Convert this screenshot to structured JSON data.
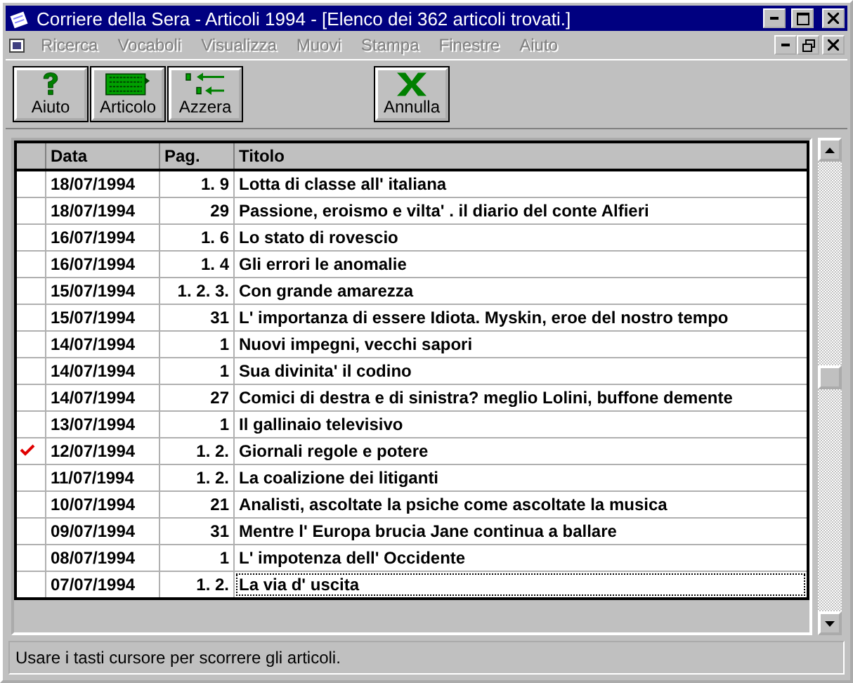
{
  "window": {
    "title": "Corriere della Sera -  Articoli 1994 - [Elenco dei 362 articoli trovati.]"
  },
  "menu": [
    {
      "label": "Ricerca",
      "disabled": true
    },
    {
      "label": "Vocaboli",
      "disabled": true
    },
    {
      "label": "Visualizza",
      "disabled": true
    },
    {
      "label": "Muovi",
      "disabled": true
    },
    {
      "label": "Stampa",
      "disabled": true
    },
    {
      "label": "Finestre",
      "disabled": true
    },
    {
      "label": "Aiuto",
      "disabled": true
    }
  ],
  "toolbar": [
    {
      "kind": "help",
      "label": "Aiuto"
    },
    {
      "kind": "article",
      "label": "Articolo"
    },
    {
      "kind": "reset",
      "label": "Azzera"
    },
    {
      "kind": "cancel",
      "label": "Annulla"
    }
  ],
  "table": {
    "columns": [
      "Data",
      "Pag.",
      "Titolo"
    ],
    "rows": [
      {
        "date": "18/07/1994",
        "page": "1. 9",
        "title": "Lotta di classe all' italiana",
        "checked": false,
        "focused": false
      },
      {
        "date": "18/07/1994",
        "page": "29",
        "title": "Passione, eroismo e vilta' . il diario del conte Alfieri",
        "checked": false,
        "focused": false
      },
      {
        "date": "16/07/1994",
        "page": "1. 6",
        "title": "Lo stato di rovescio",
        "checked": false,
        "focused": false
      },
      {
        "date": "16/07/1994",
        "page": "1. 4",
        "title": "Gli errori le anomalie",
        "checked": false,
        "focused": false
      },
      {
        "date": "15/07/1994",
        "page": "1. 2. 3.",
        "title": "Con grande amarezza",
        "checked": false,
        "focused": false
      },
      {
        "date": "15/07/1994",
        "page": "31",
        "title": "L' importanza di essere Idiota. Myskin, eroe del nostro tempo",
        "checked": false,
        "focused": false
      },
      {
        "date": "14/07/1994",
        "page": "1",
        "title": "Nuovi impegni, vecchi sapori",
        "checked": false,
        "focused": false
      },
      {
        "date": "14/07/1994",
        "page": "1",
        "title": "Sua divinita' il codino",
        "checked": false,
        "focused": false
      },
      {
        "date": "14/07/1994",
        "page": "27",
        "title": "Comici di destra e di sinistra? meglio Lolini, buffone demente",
        "checked": false,
        "focused": false
      },
      {
        "date": "13/07/1994",
        "page": "1",
        "title": "Il gallinaio televisivo",
        "checked": false,
        "focused": false
      },
      {
        "date": "12/07/1994",
        "page": "1. 2.",
        "title": "Giornali regole e potere",
        "checked": true,
        "focused": false
      },
      {
        "date": "11/07/1994",
        "page": "1. 2.",
        "title": "La coalizione dei litiganti",
        "checked": false,
        "focused": false
      },
      {
        "date": "10/07/1994",
        "page": "21",
        "title": "Analisti, ascoltate la psiche come ascoltate la musica",
        "checked": false,
        "focused": false
      },
      {
        "date": "09/07/1994",
        "page": "31",
        "title": "Mentre l' Europa brucia Jane continua a ballare",
        "checked": false,
        "focused": false
      },
      {
        "date": "08/07/1994",
        "page": "1",
        "title": "L' impotenza dell' Occidente",
        "checked": false,
        "focused": false
      },
      {
        "date": "07/07/1994",
        "page": "1. 2.",
        "title": "La via d' uscita",
        "checked": false,
        "focused": true
      }
    ]
  },
  "status_bar": "Usare i tasti cursore per scorrere gli articoli."
}
